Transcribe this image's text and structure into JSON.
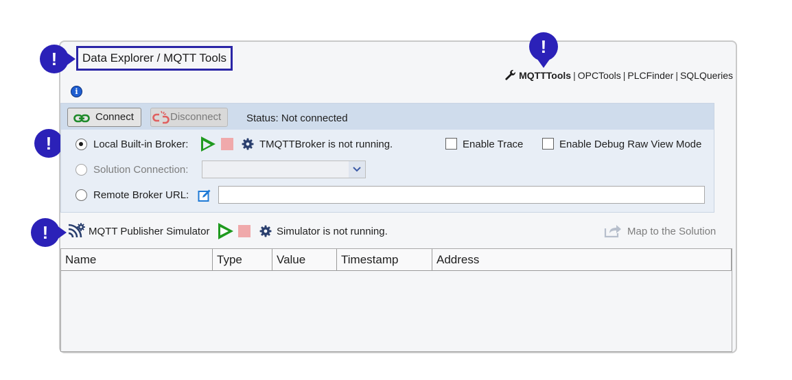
{
  "header": {
    "title": "Data Explorer / MQTT Tools",
    "tools": {
      "active": "MQTTTools",
      "links": [
        "OPCTools",
        "PLCFinder",
        "SQLQueries"
      ],
      "separator": "|"
    }
  },
  "callouts": {
    "symbol": "!"
  },
  "info_icon": {
    "glyph": "i"
  },
  "connection": {
    "connect_label": "Connect",
    "disconnect_label": "Disconnect",
    "status_text": "Status: Not connected",
    "options": {
      "local": {
        "label": "Local Built-in Broker:",
        "selected": true,
        "status": "TMQTTBroker is not running."
      },
      "solution": {
        "label": "Solution Connection:",
        "selected": false,
        "value": ""
      },
      "remote": {
        "label": "Remote Broker URL:",
        "selected": false,
        "value": ""
      }
    },
    "enable_trace_label": "Enable Trace",
    "enable_trace_checked": false,
    "enable_debug_label": "Enable Debug Raw View Mode",
    "enable_debug_checked": false
  },
  "simulator": {
    "label": "MQTT Publisher Simulator",
    "status": "Simulator is not running.",
    "map_label": "Map to the Solution"
  },
  "grid": {
    "columns": [
      "Name",
      "Type",
      "Value",
      "Timestamp",
      "Address"
    ],
    "rows": []
  },
  "colors": {
    "callout": "#2b21b8",
    "play": "#1f9a1f",
    "stop": "#f0a9ab",
    "accent": "#1f5ed1"
  }
}
